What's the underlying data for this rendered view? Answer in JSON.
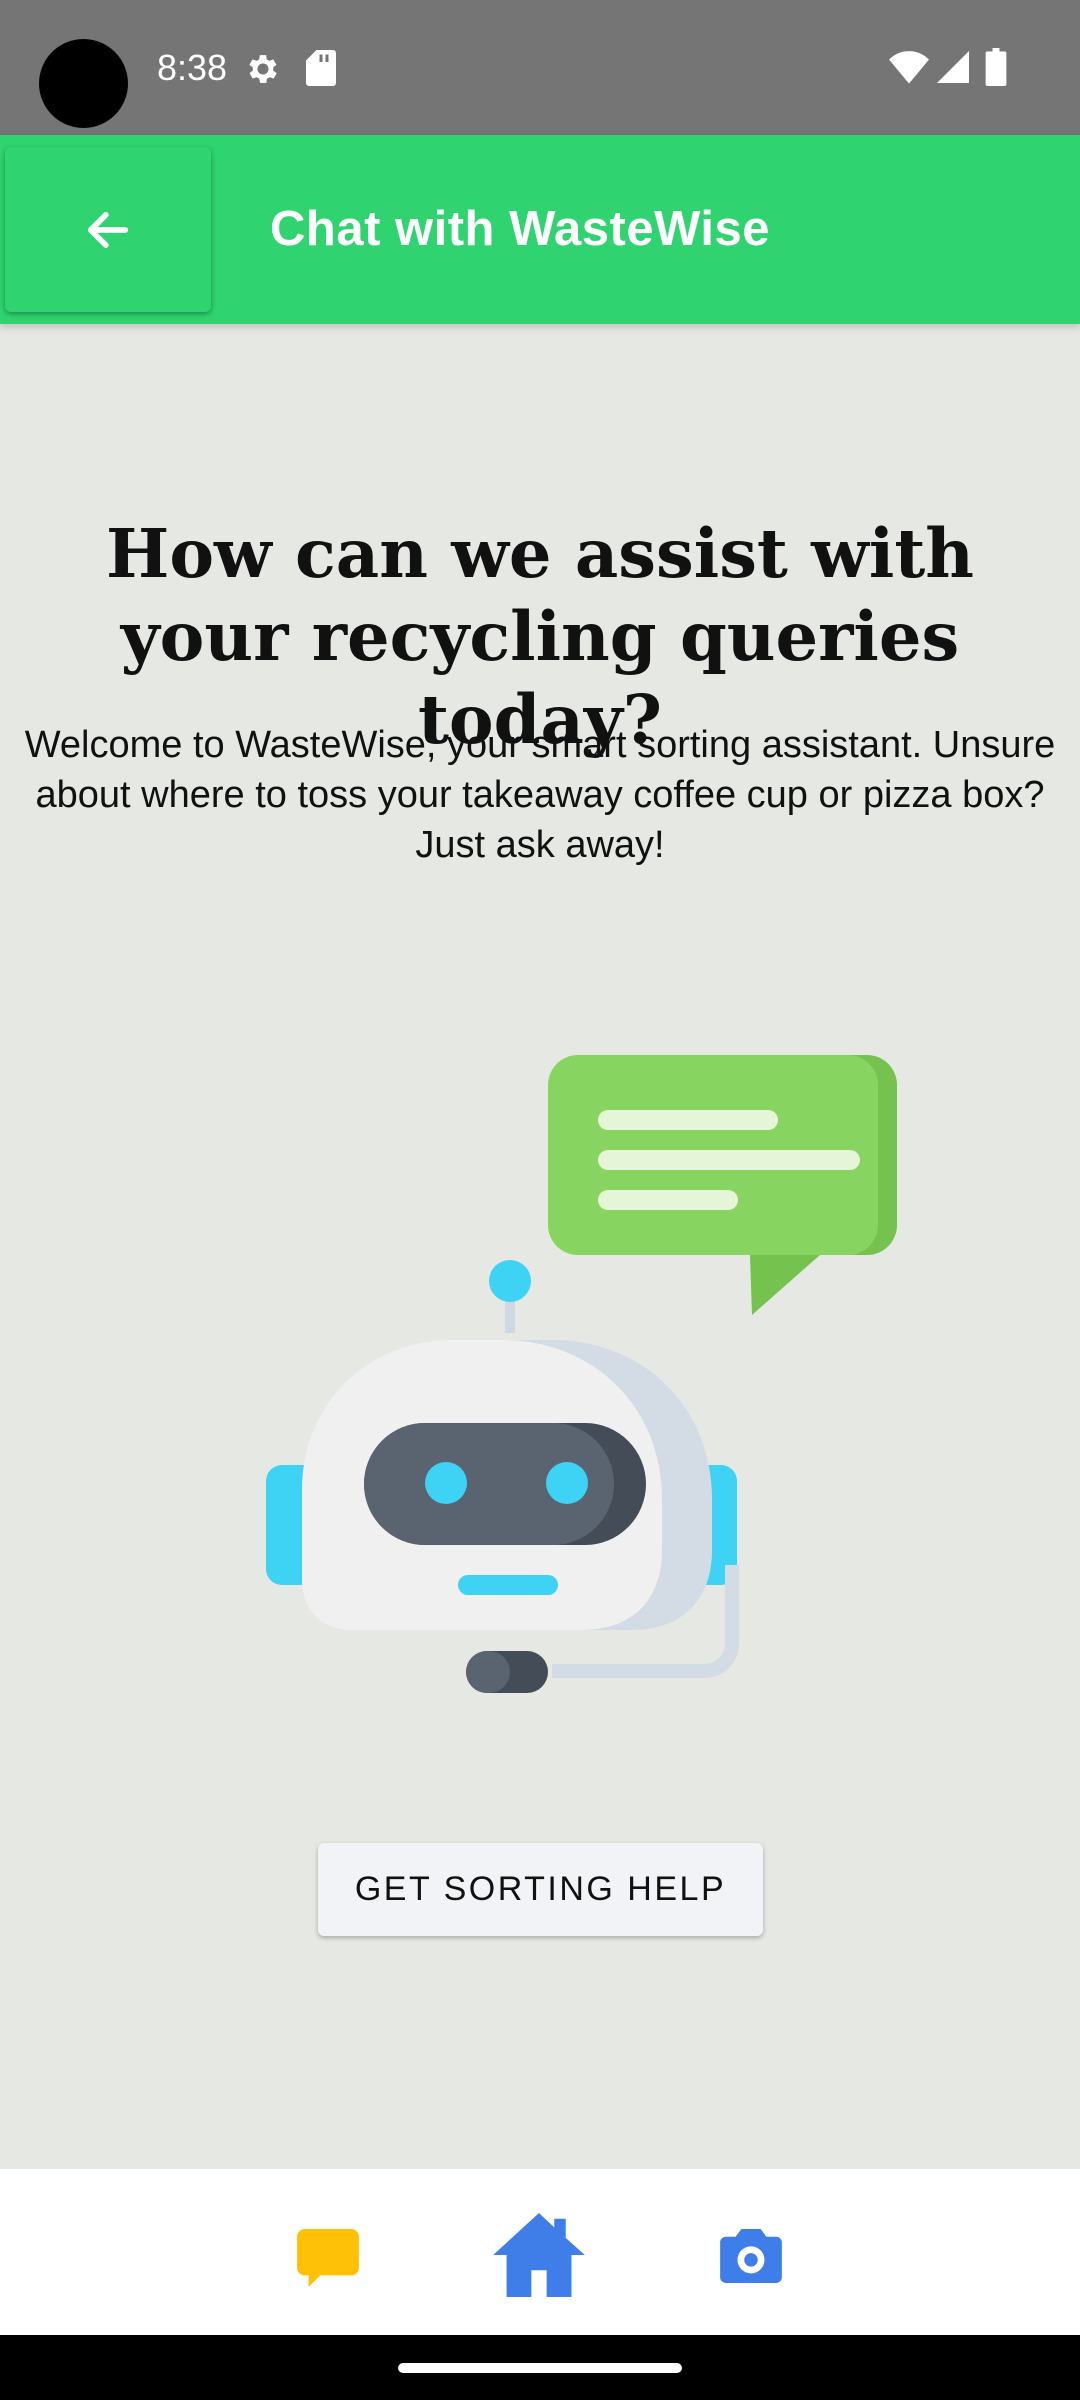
{
  "status_bar": {
    "time": "8:38",
    "icons": [
      "settings-gear-icon",
      "sd-card-icon",
      "wifi-icon",
      "signal-icon",
      "battery-icon"
    ]
  },
  "app_bar": {
    "back_icon": "arrow-left-icon",
    "title": "Chat with WasteWise",
    "color": "#2fd470"
  },
  "main": {
    "headline": "How can we assist with your recycling queries today?",
    "subtext": "Welcome to WasteWise, your smart sorting assistant. Unsure about where to toss your takeaway coffee cup or pizza box? Just ask away!",
    "illustration": "chatbot-robot-with-speech-bubble",
    "help_button_label": "GET SORTING HELP"
  },
  "bottom_nav": {
    "items": [
      {
        "icon": "chat-bubble-icon",
        "color": "#ffc107"
      },
      {
        "icon": "home-icon",
        "color": "#3f7ee8"
      },
      {
        "icon": "camera-icon",
        "color": "#3f7ee8"
      }
    ]
  }
}
